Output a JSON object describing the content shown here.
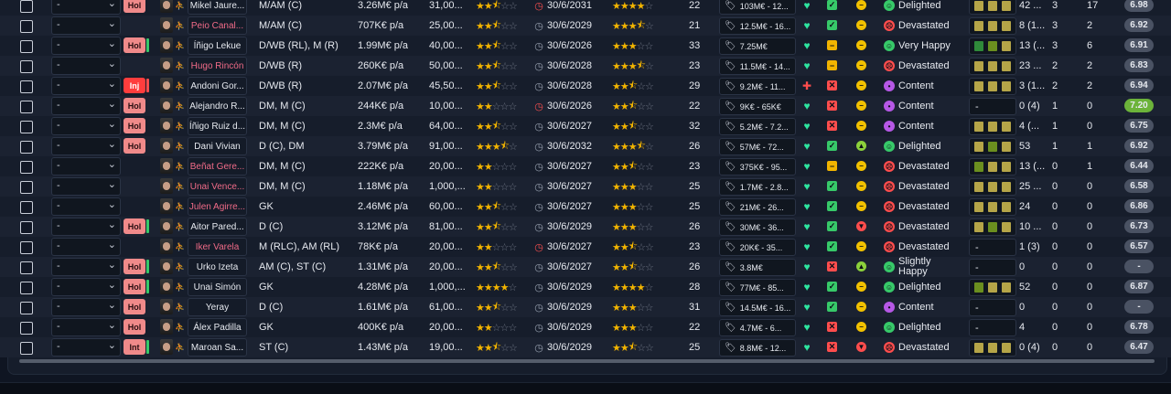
{
  "colors": {
    "green_bar": "#37c969",
    "red_bar": "#ff4d4d",
    "badge_red": "#f08a8a",
    "badge_inj": "#ff3d3d",
    "heart_green": "#2ee5a0",
    "heart_red": "#ff4d4d",
    "rating_green": "#6cb33a"
  },
  "rows": [
    {
      "sel": "-",
      "badge": "Hol",
      "badge_type": "hol",
      "bar": "none",
      "name": "Mikel Jaure...",
      "pink": false,
      "pos": "M/AM (C)",
      "wage": "3.26M€ p/a",
      "value": "31,00...",
      "stars_a": 2.5,
      "clock": "red",
      "expiry": "30/6/2031",
      "stars_b": 4,
      "age": "22",
      "price": "103M€ - 12...",
      "heart": "green",
      "sq": "check",
      "dot": "neutral",
      "mood_icon": "happy",
      "mood": "Delighted",
      "blocks": [
        "#b5a548",
        "#b5a548",
        "#b5a548"
      ],
      "apps": "42 ...",
      "gls": "3",
      "ast": "17",
      "rating": "6.98",
      "rating_green": false
    },
    {
      "sel": "-",
      "badge": "",
      "badge_type": "none",
      "bar": "none",
      "name": "Peio Canal...",
      "pink": true,
      "pos": "M/AM (C)",
      "wage": "707K€ p/a",
      "value": "25,00...",
      "stars_a": 2.5,
      "clock": "grey",
      "expiry": "30/6/2029",
      "stars_b": 3.5,
      "age": "21",
      "price": "12.5M€ - 16...",
      "heart": "green",
      "sq": "check",
      "dot": "neutral",
      "mood_icon": "sad",
      "mood": "Devastated",
      "blocks": [
        "#b5a548",
        "#b5a548",
        "#b5a548"
      ],
      "apps": "8 (1...",
      "gls": "3",
      "ast": "2",
      "rating": "6.92",
      "rating_green": false
    },
    {
      "sel": "-",
      "badge": "Hol",
      "badge_type": "hol",
      "bar": "green",
      "name": "Íñigo Lekue",
      "pink": false,
      "pos": "D/WB (RL), M (R)",
      "wage": "1.99M€ p/a",
      "value": "40,00...",
      "stars_a": 2.5,
      "clock": "grey",
      "expiry": "30/6/2026",
      "stars_b": 3,
      "age": "33",
      "price": "7.25M€",
      "heart": "green",
      "sq": "minus",
      "dot": "neutral",
      "mood_icon": "happy",
      "mood": "Very Happy",
      "blocks": [
        "#2f8a3a",
        "#6b8f1f",
        "#b5a548"
      ],
      "apps": "13 (...",
      "gls": "3",
      "ast": "6",
      "rating": "6.91",
      "rating_green": false
    },
    {
      "sel": "-",
      "badge": "",
      "badge_type": "none",
      "bar": "none",
      "name": "Hugo Rincón",
      "pink": true,
      "pos": "D/WB (R)",
      "wage": "260K€ p/a",
      "value": "50,00...",
      "stars_a": 2.5,
      "clock": "grey",
      "expiry": "30/6/2028",
      "stars_b": 3.5,
      "age": "23",
      "price": "11.5M€ - 14...",
      "heart": "green",
      "sq": "minus",
      "dot": "neutral",
      "mood_icon": "sad",
      "mood": "Devastated",
      "blocks": [
        "#b5a548",
        "#b5a548",
        "#b5a548"
      ],
      "apps": "23 ...",
      "gls": "2",
      "ast": "2",
      "rating": "6.83",
      "rating_green": false
    },
    {
      "sel": "-",
      "badge": "Inj",
      "badge_type": "inj",
      "bar": "red",
      "name": "Andoni Gor...",
      "pink": false,
      "pos": "D/WB (R)",
      "wage": "2.07M€ p/a",
      "value": "45,50...",
      "stars_a": 2.5,
      "clock": "grey",
      "expiry": "30/6/2028",
      "stars_b": 2.5,
      "age": "29",
      "price": "9.2M€ - 11...",
      "heart": "red",
      "sq": "cross",
      "dot": "neutral",
      "mood_icon": "content",
      "mood": "Content",
      "blocks": [
        "#b5a548",
        "#b5a548",
        "#b5a548"
      ],
      "apps": "3 (1...",
      "gls": "2",
      "ast": "2",
      "rating": "6.94",
      "rating_green": false
    },
    {
      "sel": "-",
      "badge": "Hol",
      "badge_type": "hol",
      "bar": "none",
      "name": "Alejandro R...",
      "pink": false,
      "pos": "DM, M (C)",
      "wage": "244K€ p/a",
      "value": "10,00...",
      "stars_a": 2,
      "clock": "red",
      "expiry": "30/6/2026",
      "stars_b": 2.5,
      "age": "22",
      "price": "9K€ - 65K€",
      "heart": "green",
      "sq": "cross",
      "dot": "neutral",
      "mood_icon": "content",
      "mood": "Content",
      "blocks": [],
      "apps": "0 (4)",
      "gls": "1",
      "ast": "0",
      "rating": "7.20",
      "rating_green": true
    },
    {
      "sel": "-",
      "badge": "Hol",
      "badge_type": "hol",
      "bar": "none",
      "name": "Íñigo Ruiz d...",
      "pink": false,
      "pos": "DM, M (C)",
      "wage": "2.3M€ p/a",
      "value": "64,00...",
      "stars_a": 2.5,
      "clock": "grey",
      "expiry": "30/6/2027",
      "stars_b": 2.5,
      "age": "32",
      "price": "5.2M€ - 7.2...",
      "heart": "green",
      "sq": "cross",
      "dot": "neutral",
      "mood_icon": "content",
      "mood": "Content",
      "blocks": [
        "#b5a548",
        "#b5a548",
        "#b5a548"
      ],
      "apps": "4 (...",
      "gls": "1",
      "ast": "0",
      "rating": "6.75",
      "rating_green": false
    },
    {
      "sel": "-",
      "badge": "Hol",
      "badge_type": "hol",
      "bar": "none",
      "name": "Dani Vivian",
      "pink": false,
      "pos": "D (C), DM",
      "wage": "3.79M€ p/a",
      "value": "91,00...",
      "stars_a": 3.5,
      "clock": "grey",
      "expiry": "30/6/2032",
      "stars_b": 3.5,
      "age": "26",
      "price": "57M€ - 72...",
      "heart": "green",
      "sq": "check",
      "dot": "up",
      "mood_icon": "happy",
      "mood": "Delighted",
      "blocks": [
        "#b5a548",
        "#6b8f1f",
        "#b5a548"
      ],
      "apps": "53",
      "gls": "1",
      "ast": "1",
      "rating": "6.92",
      "rating_green": false
    },
    {
      "sel": "-",
      "badge": "",
      "badge_type": "none",
      "bar": "none",
      "name": "Beñat Gere...",
      "pink": true,
      "pos": "DM, M (C)",
      "wage": "222K€ p/a",
      "value": "20,00...",
      "stars_a": 2,
      "clock": "grey",
      "expiry": "30/6/2027",
      "stars_b": 2.5,
      "age": "23",
      "price": "375K€ - 95...",
      "heart": "green",
      "sq": "minus",
      "dot": "neutral",
      "mood_icon": "sad",
      "mood": "Devastated",
      "blocks": [
        "#6b8f1f",
        "#b5a548",
        "#b5a548"
      ],
      "apps": "13 (...",
      "gls": "0",
      "ast": "1",
      "rating": "6.44",
      "rating_green": false
    },
    {
      "sel": "-",
      "badge": "",
      "badge_type": "none",
      "bar": "none",
      "name": "Unai Vence...",
      "pink": true,
      "pos": "DM, M (C)",
      "wage": "1.18M€ p/a",
      "value": "1,000,...",
      "stars_a": 2,
      "clock": "grey",
      "expiry": "30/6/2027",
      "stars_b": 3,
      "age": "25",
      "price": "1.7M€ - 2.8...",
      "heart": "green",
      "sq": "check",
      "dot": "neutral",
      "mood_icon": "sad",
      "mood": "Devastated",
      "blocks": [
        "#b5a548",
        "#b5a548",
        "#b5a548"
      ],
      "apps": "25 ...",
      "gls": "0",
      "ast": "0",
      "rating": "6.58",
      "rating_green": false
    },
    {
      "sel": "-",
      "badge": "",
      "badge_type": "none",
      "bar": "none",
      "name": "Julen Agirre...",
      "pink": true,
      "pos": "GK",
      "wage": "2.46M€ p/a",
      "value": "60,00...",
      "stars_a": 2.5,
      "clock": "grey",
      "expiry": "30/6/2027",
      "stars_b": 3,
      "age": "25",
      "price": "21M€ - 26...",
      "heart": "green",
      "sq": "check",
      "dot": "neutral",
      "mood_icon": "sad",
      "mood": "Devastated",
      "blocks": [
        "#b5a548",
        "#b5a548",
        "#b5a548"
      ],
      "apps": "24",
      "gls": "0",
      "ast": "0",
      "rating": "6.86",
      "rating_green": false
    },
    {
      "sel": "-",
      "badge": "Hol",
      "badge_type": "hol",
      "bar": "green",
      "name": "Aitor Pared...",
      "pink": false,
      "pos": "D (C)",
      "wage": "3.12M€ p/a",
      "value": "81,00...",
      "stars_a": 2.5,
      "clock": "grey",
      "expiry": "30/6/2029",
      "stars_b": 3,
      "age": "26",
      "price": "30M€ - 36...",
      "heart": "green",
      "sq": "check",
      "dot": "down",
      "mood_icon": "sad",
      "mood": "Devastated",
      "blocks": [
        "#b5a548",
        "#6b8f1f",
        "#b5a548"
      ],
      "apps": "10 ...",
      "gls": "0",
      "ast": "0",
      "rating": "6.73",
      "rating_green": false
    },
    {
      "sel": "-",
      "badge": "",
      "badge_type": "none",
      "bar": "none",
      "name": "Iker Varela",
      "pink": true,
      "pos": "M (RLC), AM (RL)",
      "wage": "78K€ p/a",
      "value": "20,00...",
      "stars_a": 2,
      "clock": "red",
      "expiry": "30/6/2027",
      "stars_b": 2.5,
      "age": "23",
      "price": "20K€ - 35...",
      "heart": "green",
      "sq": "check",
      "dot": "neutral",
      "mood_icon": "sad",
      "mood": "Devastated",
      "blocks": [],
      "apps": "1 (3)",
      "gls": "0",
      "ast": "0",
      "rating": "6.57",
      "rating_green": false
    },
    {
      "sel": "-",
      "badge": "Hol",
      "badge_type": "hol",
      "bar": "green",
      "name": "Urko Izeta",
      "pink": false,
      "pos": "AM (C), ST (C)",
      "wage": "1.31M€ p/a",
      "value": "20,00...",
      "stars_a": 2.5,
      "clock": "grey",
      "expiry": "30/6/2027",
      "stars_b": 2.5,
      "age": "26",
      "price": "3.8M€",
      "heart": "green",
      "sq": "cross",
      "dot": "up",
      "mood_icon": "happy",
      "mood": "Slightly Happy",
      "blocks": [],
      "apps": "0",
      "gls": "0",
      "ast": "0",
      "rating": "-",
      "rating_green": false
    },
    {
      "sel": "-",
      "badge": "Hol",
      "badge_type": "hol",
      "bar": "green",
      "name": "Unai Simón",
      "pink": false,
      "pos": "GK",
      "wage": "4.28M€ p/a",
      "value": "1,000,...",
      "stars_a": 4,
      "clock": "grey",
      "expiry": "30/6/2029",
      "stars_b": 4,
      "age": "28",
      "price": "77M€ - 85...",
      "heart": "green",
      "sq": "check",
      "dot": "neutral",
      "mood_icon": "happy",
      "mood": "Delighted",
      "blocks": [
        "#6b8f1f",
        "#b5a548",
        "#b5a548"
      ],
      "apps": "52",
      "gls": "0",
      "ast": "0",
      "rating": "6.87",
      "rating_green": false
    },
    {
      "sel": "-",
      "badge": "Hol",
      "badge_type": "hol",
      "bar": "none",
      "name": "Yeray",
      "pink": false,
      "pos": "D (C)",
      "wage": "1.61M€ p/a",
      "value": "61,00...",
      "stars_a": 2.5,
      "clock": "grey",
      "expiry": "30/6/2029",
      "stars_b": 3,
      "age": "31",
      "price": "14.5M€ - 16...",
      "heart": "green",
      "sq": "check",
      "dot": "neutral",
      "mood_icon": "content",
      "mood": "Content",
      "blocks": [],
      "apps": "0",
      "gls": "0",
      "ast": "0",
      "rating": "-",
      "rating_green": false
    },
    {
      "sel": "-",
      "badge": "Hol",
      "badge_type": "hol",
      "bar": "none",
      "name": "Álex Padilla",
      "pink": false,
      "pos": "GK",
      "wage": "400K€ p/a",
      "value": "20,00...",
      "stars_a": 2,
      "clock": "grey",
      "expiry": "30/6/2029",
      "stars_b": 3,
      "age": "22",
      "price": "4.7M€ - 6...",
      "heart": "green",
      "sq": "cross",
      "dot": "neutral",
      "mood_icon": "happy",
      "mood": "Delighted",
      "blocks": [],
      "apps": "4",
      "gls": "0",
      "ast": "0",
      "rating": "6.78",
      "rating_green": false
    },
    {
      "sel": "-",
      "badge": "Int",
      "badge_type": "int",
      "bar": "green",
      "name": "Maroan Sa...",
      "pink": false,
      "pos": "ST (C)",
      "wage": "1.43M€ p/a",
      "value": "19,00...",
      "stars_a": 2.5,
      "clock": "grey",
      "expiry": "30/6/2029",
      "stars_b": 2.5,
      "age": "25",
      "price": "8.8M€ - 12...",
      "heart": "green",
      "sq": "cross",
      "dot": "down",
      "mood_icon": "sad",
      "mood": "Devastated",
      "blocks": [
        "#b5a548",
        "#b5a548",
        "#b5a548"
      ],
      "apps": "0 (4)",
      "gls": "0",
      "ast": "0",
      "rating": "6.47",
      "rating_green": false
    }
  ]
}
